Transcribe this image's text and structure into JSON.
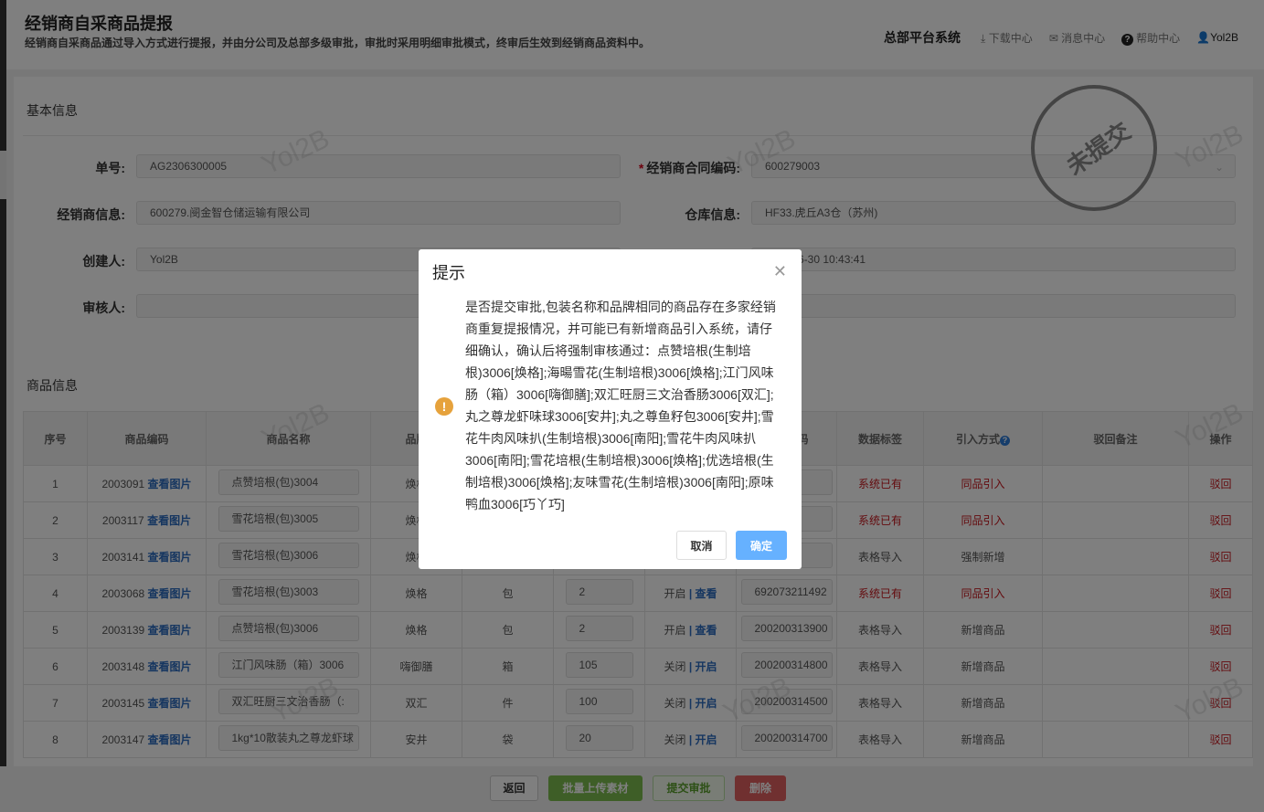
{
  "header": {
    "title": "经销商自采商品提报",
    "subtitle": "经销商自采商品通过导入方式进行提报，并由分公司及总部多级审批，审批时采用明细审批模式，终审后生效到经销商品资料中。",
    "system": "总部平台系统",
    "download": "下载中心",
    "message": "消息中心",
    "help": "帮助中心",
    "user": "Yol2B"
  },
  "basic": {
    "section": "基本信息",
    "order_label": "单号:",
    "order_value": "AG2306300005",
    "contract_label": "经销商合同编码:",
    "contract_value": "600279003",
    "dealer_label": "经销商信息:",
    "dealer_value": "600279.阌金智仓储运输有限公司",
    "warehouse_label": "仓库信息:",
    "warehouse_value": "HF33.虎丘A3仓（苏州)",
    "creator_label": "创建人:",
    "creator_value": "Yol2B",
    "created_time": "6-30 10:43:41",
    "reviewer_label": "审核人:",
    "stamp": "未提交"
  },
  "watermark": "Yol2B",
  "goods": {
    "section": "商品信息",
    "columns": [
      "序号",
      "商品编码",
      "商品名称",
      "品牌",
      "",
      "",
      "",
      "商品条码",
      "数据标签",
      "引入方式",
      "驳回备注",
      "操作"
    ],
    "view_image": "查看图片",
    "reject": "驳回",
    "rows": [
      {
        "no": "1",
        "code": "2003091",
        "name": "点赞培根(包)3004",
        "brand": "焕格",
        "unit": "",
        "qty": "",
        "s1": "",
        "s2": "",
        "barcode": "211492",
        "tag": "系统已有",
        "tag_red": true,
        "method": "同品引入",
        "method_red": true
      },
      {
        "no": "2",
        "code": "2003117",
        "name": "雪花培根(包)3005",
        "brand": "焕格",
        "unit": "",
        "qty": "",
        "s1": "",
        "s2": "",
        "barcode": "211492",
        "tag": "系统已有",
        "tag_red": true,
        "method": "同品引入",
        "method_red": true
      },
      {
        "no": "3",
        "code": "2003141",
        "name": "雪花培根(包)3006",
        "brand": "焕格",
        "unit": "",
        "qty": "",
        "s1": "",
        "s2": "",
        "barcode": "211492",
        "tag": "表格导入",
        "tag_red": false,
        "method": "强制新增",
        "method_red": false
      },
      {
        "no": "4",
        "code": "2003068",
        "name": "雪花培根(包)3003",
        "brand": "焕格",
        "unit": "包",
        "qty": "2",
        "s1": "开启",
        "s2": "查看",
        "barcode": "692073211492",
        "tag": "系统已有",
        "tag_red": true,
        "method": "同品引入",
        "method_red": true
      },
      {
        "no": "5",
        "code": "2003139",
        "name": "点赞培根(包)3006",
        "brand": "焕格",
        "unit": "包",
        "qty": "2",
        "s1": "开启",
        "s2": "查看",
        "barcode": "200200313900",
        "tag": "表格导入",
        "tag_red": false,
        "method": "新增商品",
        "method_red": false
      },
      {
        "no": "6",
        "code": "2003148",
        "name": "江门风味肠（箱）3006",
        "brand": "嗨御膳",
        "unit": "箱",
        "qty": "105",
        "s1": "关闭",
        "s2": "开启",
        "barcode": "200200314800",
        "tag": "表格导入",
        "tag_red": false,
        "method": "新增商品",
        "method_red": false
      },
      {
        "no": "7",
        "code": "2003145",
        "name": "双汇旺厨三文治香肠（:",
        "brand": "双汇",
        "unit": "件",
        "qty": "100",
        "s1": "关闭",
        "s2": "开启",
        "barcode": "200200314500",
        "tag": "表格导入",
        "tag_red": false,
        "method": "新增商品",
        "method_red": false
      },
      {
        "no": "8",
        "code": "2003147",
        "name": "1kg*10散装丸之尊龙虾球",
        "brand": "安井",
        "unit": "袋",
        "qty": "20",
        "s1": "关闭",
        "s2": "开启",
        "barcode": "200200314700",
        "tag": "表格导入",
        "tag_red": false,
        "method": "新增商品",
        "method_red": false
      }
    ]
  },
  "footer": {
    "back": "返回",
    "upload": "批量上传素材",
    "submit": "提交审批",
    "delete": "删除"
  },
  "modal": {
    "title": "提示",
    "message": "是否提交审批,包装名称和品牌相同的商品存在多家经销商重复提报情况，并可能已有新增商品引入系统，请仔细确认，确认后将强制审核通过：点赞培根(生制培根)3006[焕格];海暘雪花(生制培根)3006[焕格];江门风味肠（箱）3006[嗨御膳];双汇旺厨三文治香肠3006[双汇];丸之尊龙虾味球3006[安井];丸之尊鱼籽包3006[安井];雪花牛肉风味扒(生制培根)3006[南阳];雪花牛肉风味扒3006[南阳];雪花培根(生制培根)3006[焕格];优选培根(生制培根)3006[焕格];友味雪花(生制培根)3006[南阳];原味鸭血3006[巧丫巧]",
    "cancel": "取消",
    "ok": "确定"
  },
  "colors": {
    "link": "#2d6cc0",
    "danger": "#c8161d",
    "primary": "#66b1ff",
    "warning": "#e6a23c"
  }
}
